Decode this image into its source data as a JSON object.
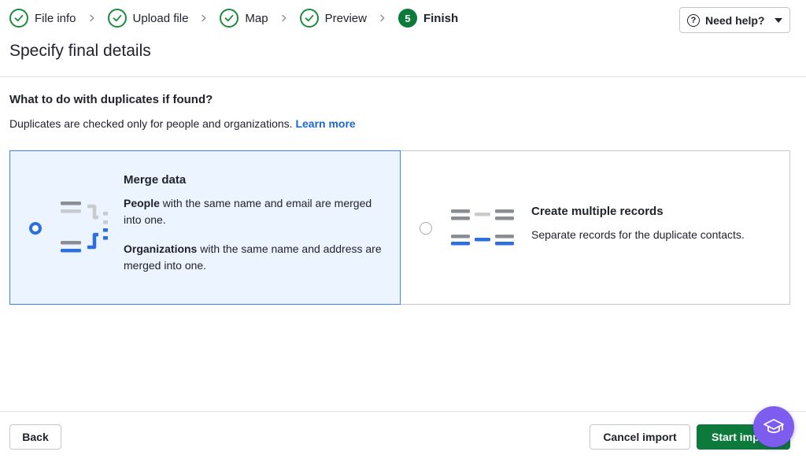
{
  "stepper": {
    "steps": [
      {
        "label": "File info",
        "state": "done"
      },
      {
        "label": "Upload file",
        "state": "done"
      },
      {
        "label": "Map",
        "state": "done"
      },
      {
        "label": "Preview",
        "state": "done"
      },
      {
        "label": "Finish",
        "state": "current",
        "number": "5"
      }
    ]
  },
  "header": {
    "help_label": "Need help?",
    "page_title": "Specify final details"
  },
  "duplicates": {
    "question": "What to do with duplicates if found?",
    "description": "Duplicates are checked only for people and organizations.",
    "learn_more": "Learn more",
    "options": [
      {
        "title": "Merge data",
        "selected": true,
        "people_strong": "People",
        "people_rest": " with the same name and email are merged into one.",
        "orgs_strong": "Organizations",
        "orgs_rest": " with the same name and address are merged into one."
      },
      {
        "title": "Create multiple records",
        "selected": false,
        "text": "Separate records for the duplicate contacts."
      }
    ]
  },
  "footer": {
    "back_label": "Back",
    "cancel_label": "Cancel import",
    "start_label": "Start import"
  },
  "colors": {
    "success_green": "#0c7a3a",
    "accent_blue": "#2d6fe0",
    "selected_bg": "#ecf4ff",
    "academy_purple": "#7e5cf0"
  },
  "icons": {
    "help": "question-circle-icon",
    "done_step": "check-circle-icon",
    "separator": "chevron-right-icon",
    "fab": "graduation-cap-icon"
  }
}
